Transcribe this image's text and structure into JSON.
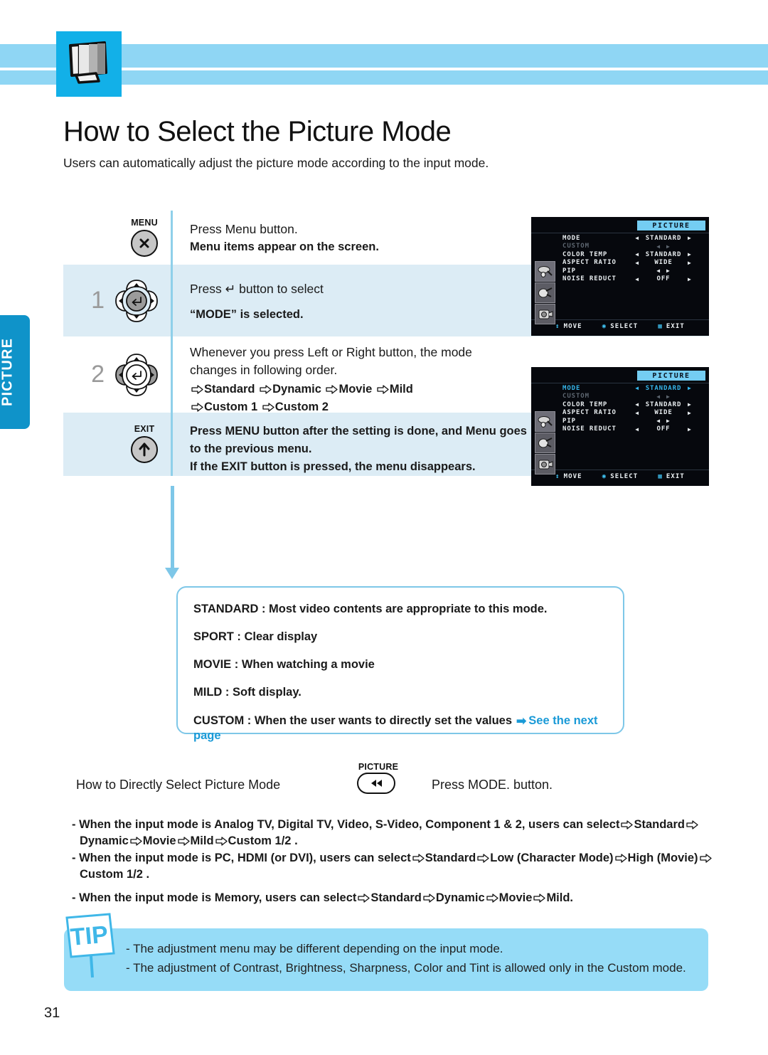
{
  "header": {
    "icon": "tv-monitor-icon",
    "band_color": "#8fd6f4",
    "box_color": "#12b0e8"
  },
  "side_tab": {
    "label": "PICTURE",
    "color": "#0f93c9"
  },
  "title": "How to Select the Picture Mode",
  "subtitle": "Users can automatically adjust the picture mode according to the input mode.",
  "steps": [
    {
      "num": "",
      "button_label": "MENU",
      "button_icon": "close-x-icon",
      "lines": [
        {
          "text": "Press Menu button.",
          "bold": false
        },
        {
          "text": "Menu items appear on the screen.",
          "bold": true
        }
      ]
    },
    {
      "num": "1",
      "button_label": "",
      "button_icon": "dpad-enter-icon",
      "lines": [
        {
          "text": "Press ↵ button to select",
          "bold": false
        },
        {
          "text": "“MODE” is selected.",
          "bold": true
        }
      ]
    },
    {
      "num": "2",
      "button_label": "",
      "button_icon": "dpad-leftright-icon",
      "lines": [
        {
          "text": "Whenever you press Left or Right button, the mode",
          "bold": false
        },
        {
          "text": "changes in following order.",
          "bold": false
        },
        {
          "text": "Standard   Dynamic   Movie   Mild",
          "bold": true
        },
        {
          "text": "Custom 1   Custom 2",
          "bold": true
        }
      ]
    },
    {
      "num": "",
      "button_label": "EXIT",
      "button_icon": "up-arrow-icon",
      "lines": [
        {
          "text": "Press MENU button after the setting is done, and Menu goes",
          "bold": true
        },
        {
          "text": "to the previous menu.",
          "bold": true
        },
        {
          "text": "If the EXIT button is pressed, the menu disappears.",
          "bold": true
        }
      ]
    }
  ],
  "description_box": {
    "lines": [
      "STANDARD : Most video contents are appropriate to this mode.",
      "SPORT : Clear display",
      "MOVIE : When watching a movie",
      "MILD : Soft display.",
      "CUSTOM : When the user wants to directly set the values"
    ],
    "link_text": "See the next page",
    "link_color": "#1a9ad7"
  },
  "direct_select": {
    "text": "How to Directly Select Picture Mode",
    "button_label": "PICTURE",
    "button_icon": "rewind-icon",
    "press_text": "Press MODE. button."
  },
  "bullets": [
    {
      "line1": "- When the input mode is Analog TV, Digital TV, Video, S-Video, Component 1 & 2, users can select",
      "items1": [
        "Standard"
      ],
      "line2_items": [
        "Dynamic",
        "Movie",
        "Mild",
        "Custom 1/2 ."
      ]
    },
    {
      "line1": "- When the input mode is PC, HDMI (or DVI), users can select",
      "items1": [
        "Standard",
        "Low (Character Mode)",
        "High (Movie)"
      ],
      "line2_items": [
        "Custom 1/2 ."
      ]
    },
    {
      "line1": "- When the input mode is Memory, users can select",
      "items1": [
        "Standard",
        "Dynamic",
        "Movie",
        "Mild."
      ],
      "line2_items": []
    }
  ],
  "tip": {
    "label": "TIP",
    "lines": [
      "- The adjustment menu may be different depending on the input mode.",
      "- The adjustment of Contrast, Brightness, Sharpness, Color and Tint is allowed only in the Custom mode."
    ],
    "box_color": "#96dcf7"
  },
  "osd_screens": [
    {
      "title": "PICTURE",
      "rows": [
        {
          "label": "MODE",
          "value": "STANDARD",
          "state": "normal",
          "arrows": true
        },
        {
          "label": "CUSTOM",
          "value": "",
          "state": "dim",
          "arrows": true
        },
        {
          "label": "COLOR TEMP",
          "value": "STANDARD",
          "state": "normal",
          "arrows": true
        },
        {
          "label": "ASPECT RATIO",
          "value": "WIDE",
          "state": "normal",
          "arrows": true
        },
        {
          "label": "PIP",
          "value": "",
          "state": "normal",
          "arrows": true
        },
        {
          "label": "NOISE REDUCT",
          "value": "OFF",
          "state": "normal",
          "arrows": true
        }
      ],
      "footer": [
        {
          "icon": "updown-icon",
          "label": "MOVE"
        },
        {
          "icon": "leftright-icon",
          "label": "SELECT"
        },
        {
          "icon": "menu-icon",
          "label": "EXIT"
        }
      ]
    },
    {
      "title": "PICTURE",
      "rows": [
        {
          "label": "MODE",
          "value": "STANDARD",
          "state": "selected",
          "arrows": true
        },
        {
          "label": "CUSTOM",
          "value": "",
          "state": "dim",
          "arrows": true
        },
        {
          "label": "COLOR TEMP",
          "value": "STANDARD",
          "state": "normal",
          "arrows": true
        },
        {
          "label": "ASPECT RATIO",
          "value": "WIDE",
          "state": "normal",
          "arrows": true
        },
        {
          "label": "PIP",
          "value": "",
          "state": "normal",
          "arrows": true
        },
        {
          "label": "NOISE REDUCT",
          "value": "OFF",
          "state": "normal",
          "arrows": true
        }
      ],
      "footer": [
        {
          "icon": "updown-icon",
          "label": "MOVE"
        },
        {
          "icon": "leftright-icon",
          "label": "SELECT"
        },
        {
          "icon": "menu-icon",
          "label": "EXIT"
        }
      ]
    }
  ],
  "page_number": "31"
}
